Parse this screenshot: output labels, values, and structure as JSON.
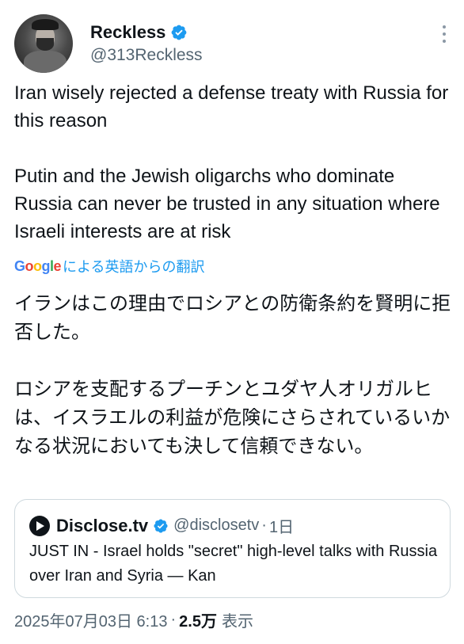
{
  "author": {
    "display_name": "Reckless",
    "handle": "@313Reckless",
    "verified_color": "#1d9bf0"
  },
  "tweet": {
    "text": "Iran wisely rejected a defense treaty with Russia for this reason\n\nPutin and the Jewish oligarchs who dominate Russia can never be trusted in any situation where Israeli interests are at risk",
    "translate_label": "による英語からの翻訳",
    "translated_text": "イランはこの理由でロシアとの防衛条約を賢明に拒否した。\n\nロシアを支配するプーチンとユダヤ人オリガルヒは、イスラエルの利益が危険にさらされているいかなる状況においても決して信頼できない。"
  },
  "google_logo": [
    "G",
    "o",
    "o",
    "g",
    "l",
    "e"
  ],
  "quote": {
    "display_name": "Disclose.tv",
    "handle": "@disclosetv",
    "time": "1日",
    "text": "JUST IN - Israel holds \"secret\" high-level talks with Russia over Iran and Syria — Kan"
  },
  "meta": {
    "timestamp": "2025年07月03日 6:13",
    "views_count": "2.5万",
    "views_label": "表示",
    "separator": "·"
  }
}
